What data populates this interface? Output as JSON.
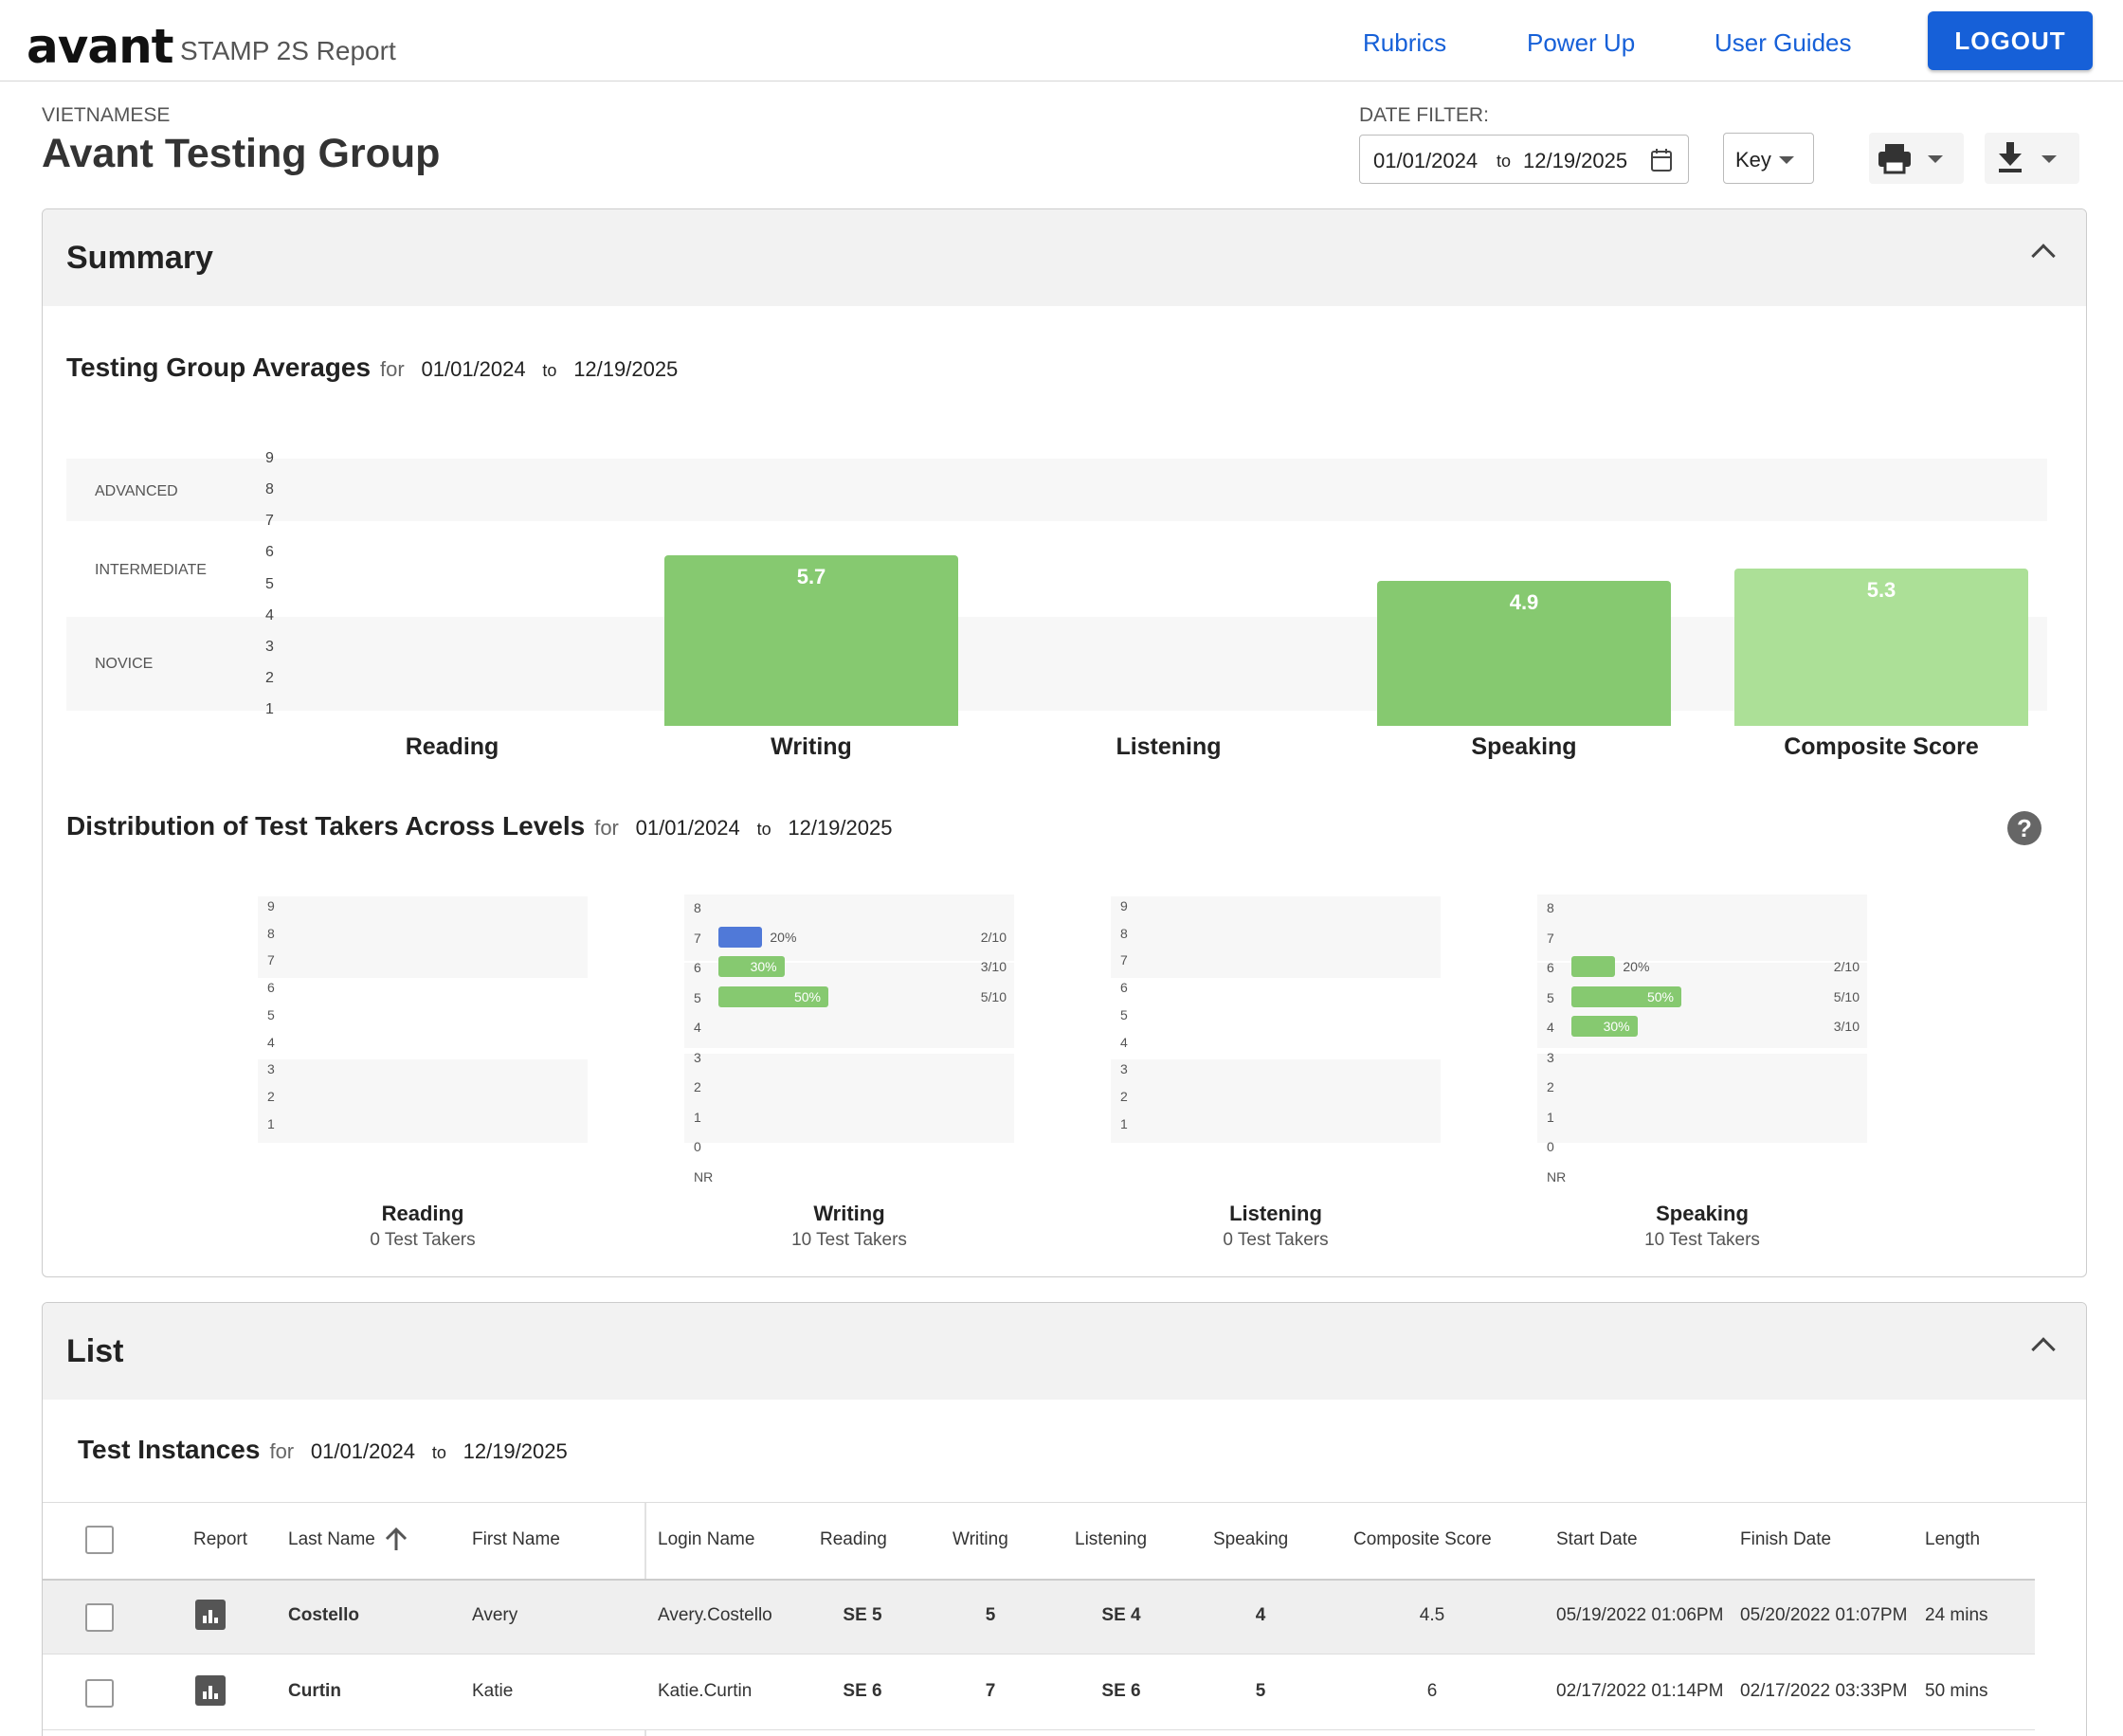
{
  "header": {
    "logo": "avant",
    "app_name": "STAMP 2S Report",
    "nav": [
      {
        "label": "Rubrics"
      },
      {
        "label": "Power Up"
      },
      {
        "label": "User Guides"
      }
    ],
    "logout": "LOGOUT"
  },
  "page": {
    "language": "VIETNAMESE",
    "group": "Avant Testing Group"
  },
  "date_filter": {
    "label": "DATE FILTER:",
    "from": "01/01/2024",
    "to_word": "to",
    "to": "12/19/2025"
  },
  "key_button": "Key",
  "icons": {
    "print": "print-icon",
    "download": "download-icon",
    "calendar": "calendar-icon",
    "help": "help-icon",
    "report": "bar-chart-icon",
    "sort": "arrow-up-icon",
    "collapse": "chevron-up-icon"
  },
  "summary": {
    "title": "Summary",
    "averages_title": "Testing Group Averages",
    "distribution_title": "Distribution of Test Takers Across Levels",
    "for": "for",
    "from": "01/01/2024",
    "to_word": "to",
    "to": "12/19/2025",
    "help": "?"
  },
  "chart_data": [
    {
      "type": "bar",
      "title": "Testing Group Averages",
      "categories": [
        "Reading",
        "Writing",
        "Listening",
        "Speaking",
        "Composite Score"
      ],
      "values": [
        null,
        5.7,
        null,
        4.9,
        5.3
      ],
      "value_labels": [
        "",
        "5.7",
        "",
        "4.9",
        "5.3"
      ],
      "ylim": [
        1,
        9
      ],
      "yticks": [
        "1",
        "2",
        "3",
        "4",
        "5",
        "6",
        "7",
        "8",
        "9"
      ],
      "bands": [
        "NOVICE",
        "INTERMEDIATE",
        "ADVANCED"
      ],
      "colors": {
        "bar": "#86c970",
        "composite": "#ace097"
      }
    },
    {
      "type": "bar",
      "orientation": "horizontal",
      "title": "Reading",
      "subtitle": "0 Test Takers",
      "yticks": [
        "9",
        "8",
        "7",
        "6",
        "5",
        "4",
        "3",
        "2",
        "1"
      ],
      "bars": []
    },
    {
      "type": "bar",
      "orientation": "horizontal",
      "title": "Writing",
      "subtitle": "10 Test Takers",
      "yticks": [
        "8",
        "7",
        "6",
        "5",
        "4",
        "3",
        "2",
        "1",
        "0",
        "NR"
      ],
      "bars": [
        {
          "level": "7",
          "percent": 20,
          "label": "20%",
          "fraction": "2/10",
          "color": "#5079d8"
        },
        {
          "level": "6",
          "percent": 30,
          "label": "30%",
          "fraction": "3/10",
          "color": "#86c970"
        },
        {
          "level": "5",
          "percent": 50,
          "label": "50%",
          "fraction": "5/10",
          "color": "#86c970"
        }
      ]
    },
    {
      "type": "bar",
      "orientation": "horizontal",
      "title": "Listening",
      "subtitle": "0 Test Takers",
      "yticks": [
        "9",
        "8",
        "7",
        "6",
        "5",
        "4",
        "3",
        "2",
        "1"
      ],
      "bars": []
    },
    {
      "type": "bar",
      "orientation": "horizontal",
      "title": "Speaking",
      "subtitle": "10 Test Takers",
      "yticks": [
        "8",
        "7",
        "6",
        "5",
        "4",
        "3",
        "2",
        "1",
        "0",
        "NR"
      ],
      "bars": [
        {
          "level": "6",
          "percent": 20,
          "label": "20%",
          "fraction": "2/10",
          "color": "#86c970"
        },
        {
          "level": "5",
          "percent": 50,
          "label": "50%",
          "fraction": "5/10",
          "color": "#86c970"
        },
        {
          "level": "4",
          "percent": 30,
          "label": "30%",
          "fraction": "3/10",
          "color": "#86c970"
        }
      ]
    }
  ],
  "list": {
    "title": "List",
    "instances_title": "Test Instances",
    "for": "for",
    "from": "01/01/2024",
    "to_word": "to",
    "to": "12/19/2025",
    "columns": [
      "Report",
      "Last Name",
      "First Name",
      "Login Name",
      "Reading",
      "Writing",
      "Listening",
      "Speaking",
      "Composite Score",
      "Start Date",
      "Finish Date",
      "Length"
    ],
    "rows": [
      {
        "last": "Costello",
        "first": "Avery",
        "login": "Avery.Costello",
        "reading": "SE 5",
        "writing": "5",
        "listening": "SE 4",
        "speaking": "4",
        "composite": "4.5",
        "start": "05/19/2022 01:06PM",
        "finish": "05/20/2022 01:07PM",
        "length": "24 mins"
      },
      {
        "last": "Curtin",
        "first": "Katie",
        "login": "Katie.Curtin",
        "reading": "SE 6",
        "writing": "7",
        "listening": "SE 6",
        "speaking": "5",
        "composite": "6",
        "start": "02/17/2022 01:14PM",
        "finish": "02/17/2022 03:33PM",
        "length": "50 mins"
      }
    ]
  }
}
